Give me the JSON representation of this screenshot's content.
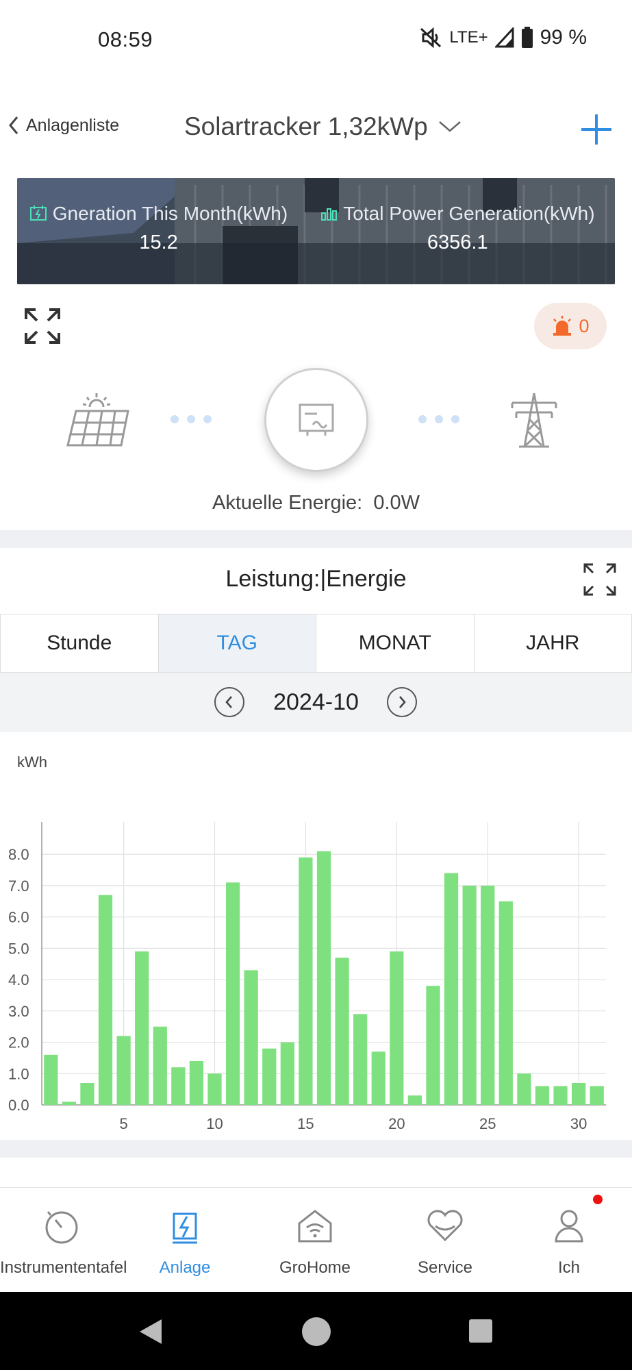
{
  "status_bar": {
    "time": "08:59",
    "network": "LTE+",
    "battery": "99 %"
  },
  "header": {
    "back_label": "Anlagenliste",
    "plant_name": "Solartracker 1,32kWp"
  },
  "stats": {
    "month_label": "Gneration This Month(kWh)",
    "month_value": "15.2",
    "total_label": "Total Power Generation(kWh)",
    "total_value": "6356.1"
  },
  "alarm_count": "0",
  "current_energy": {
    "label": "Aktuelle Energie:",
    "value": "0.0W"
  },
  "chart_section": {
    "title": "Leistung:|Energie",
    "tabs": [
      {
        "label": "Stunde",
        "active": false
      },
      {
        "label": "TAG",
        "active": true
      },
      {
        "label": "MONAT",
        "active": false
      },
      {
        "label": "JAHR",
        "active": false
      }
    ],
    "date": "2024-10"
  },
  "chart_data": {
    "type": "bar",
    "ylabel": "kWh",
    "xlabel": "",
    "title": "",
    "x": [
      1,
      2,
      3,
      4,
      5,
      6,
      7,
      8,
      9,
      10,
      11,
      12,
      13,
      14,
      15,
      16,
      17,
      18,
      19,
      20,
      21,
      22,
      23,
      24,
      25,
      26,
      27,
      28,
      29,
      30,
      31
    ],
    "values": [
      1.6,
      0.1,
      0.7,
      6.7,
      2.2,
      4.9,
      2.5,
      1.2,
      1.4,
      1.0,
      7.1,
      4.3,
      1.8,
      2.0,
      7.9,
      8.1,
      4.7,
      2.9,
      1.7,
      4.9,
      0.3,
      3.8,
      7.4,
      7.0,
      7.0,
      6.5,
      1.0,
      0.6,
      0.6,
      0.7,
      0.6
    ],
    "yticks": [
      "0.0",
      "1.0",
      "2.0",
      "3.0",
      "4.0",
      "5.0",
      "6.0",
      "7.0",
      "8.0"
    ],
    "xticks": [
      "5",
      "10",
      "15",
      "20",
      "25",
      "30"
    ],
    "ylim": [
      0,
      8.9
    ],
    "bar_color": "#7ee07e",
    "grid": true
  },
  "nav": [
    {
      "label": "Instrumententafel",
      "icon": "dashboard-gauge-icon",
      "active": false
    },
    {
      "label": "Anlage",
      "icon": "plant-bolt-icon",
      "active": true
    },
    {
      "label": "GroHome",
      "icon": "home-wifi-icon",
      "active": false
    },
    {
      "label": "Service",
      "icon": "service-heart-icon",
      "active": false
    },
    {
      "label": "Ich",
      "icon": "person-icon",
      "active": false
    }
  ],
  "colors": {
    "accent": "#2f8ee0",
    "alarm": "#f26a2b",
    "bar": "#7ee07e"
  }
}
